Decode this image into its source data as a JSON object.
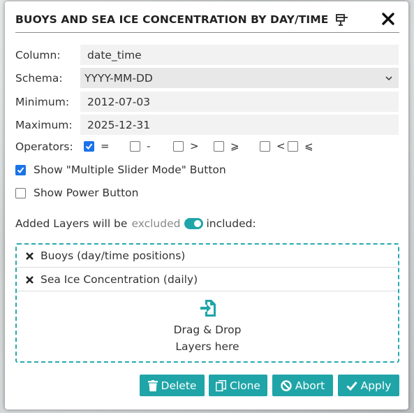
{
  "dialog": {
    "title": "BUOYS AND SEA ICE CONCENTRATION BY DAY/TIME",
    "title_icon": "pin-icon",
    "close_icon": "close-icon"
  },
  "form": {
    "column_label": "Column:",
    "column_value": "date_time",
    "schema_label": "Schema:",
    "schema_value": "YYYY-MM-DD",
    "minimum_label": "Minimum:",
    "minimum_value": "2012-07-03",
    "maximum_label": "Maximum:",
    "maximum_value": "2025-12-31",
    "operators_label": "Operators:",
    "operators": [
      {
        "symbol": "=",
        "checked": true
      },
      {
        "symbol": "-",
        "checked": false
      },
      {
        "symbol": ">",
        "checked": false
      },
      {
        "symbol": "⩾",
        "checked": false
      },
      {
        "symbol": "<",
        "checked": false
      },
      {
        "symbol": "⩽",
        "checked": false
      }
    ],
    "multi_slider_label": "Show \"Multiple Slider Mode\" Button",
    "multi_slider_checked": true,
    "power_button_label": "Show Power Button",
    "power_button_checked": false
  },
  "layers": {
    "prefix": "Added Layers will be",
    "excluded": "excluded",
    "included": "included:",
    "toggle_on": true,
    "items": [
      "Buoys (day/time positions)",
      "Sea Ice Concentration (daily)"
    ],
    "drop_line1": "Drag & Drop",
    "drop_line2": "Layers here"
  },
  "buttons": {
    "delete": "Delete",
    "clone": "Clone",
    "abort": "Abort",
    "apply": "Apply"
  },
  "colors": {
    "accent": "#1fa5a8",
    "checkbox": "#1a73e8"
  }
}
